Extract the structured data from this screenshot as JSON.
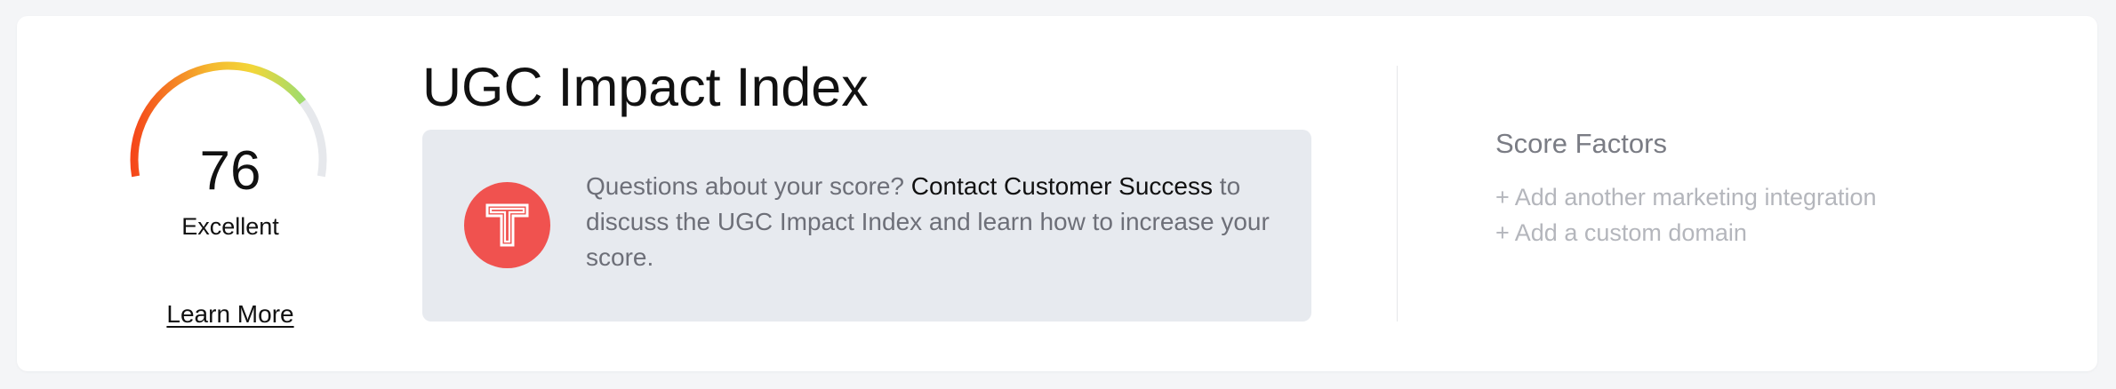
{
  "score": {
    "value": "76",
    "label": "Excellent",
    "learn_more": "Learn More",
    "gauge_fraction": 0.76,
    "gauge_colors": [
      "#f5481a",
      "#f5b82e",
      "#f3d638",
      "#9fdc6e"
    ],
    "gauge_track": "#e6e8ec"
  },
  "header": {
    "title": "UGC Impact Index"
  },
  "info": {
    "text_before": "Questions about your score? ",
    "link_text": "Contact Customer Success",
    "text_after": " to discuss the UGC Impact Index and learn how to increase your score.",
    "avatar_icon": "t-logo-icon",
    "avatar_color": "#f0524f"
  },
  "factors": {
    "title": "Score Factors",
    "items": [
      "+ Add another marketing integration",
      "+ Add a custom domain"
    ]
  }
}
